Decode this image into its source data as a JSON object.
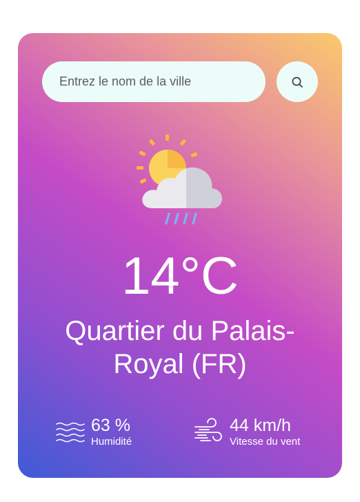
{
  "search": {
    "placeholder": "Entrez le nom de la ville",
    "value": ""
  },
  "weather": {
    "icon": "sun-cloud-rain-icon",
    "temperature": "14°C",
    "city": "Quartier du Palais-Royal (FR)"
  },
  "details": {
    "humidity": {
      "value": "63 %",
      "label": "Humidité",
      "icon": "waves-icon"
    },
    "wind": {
      "value": "44 km/h",
      "label": "Vitesse du vent",
      "icon": "wind-icon"
    }
  },
  "colors": {
    "gradient_top_right": "#fbc96b",
    "gradient_middle": "#c54bc6",
    "gradient_bottom_left": "#3d5bd6",
    "input_background": "#ecfcf9"
  }
}
